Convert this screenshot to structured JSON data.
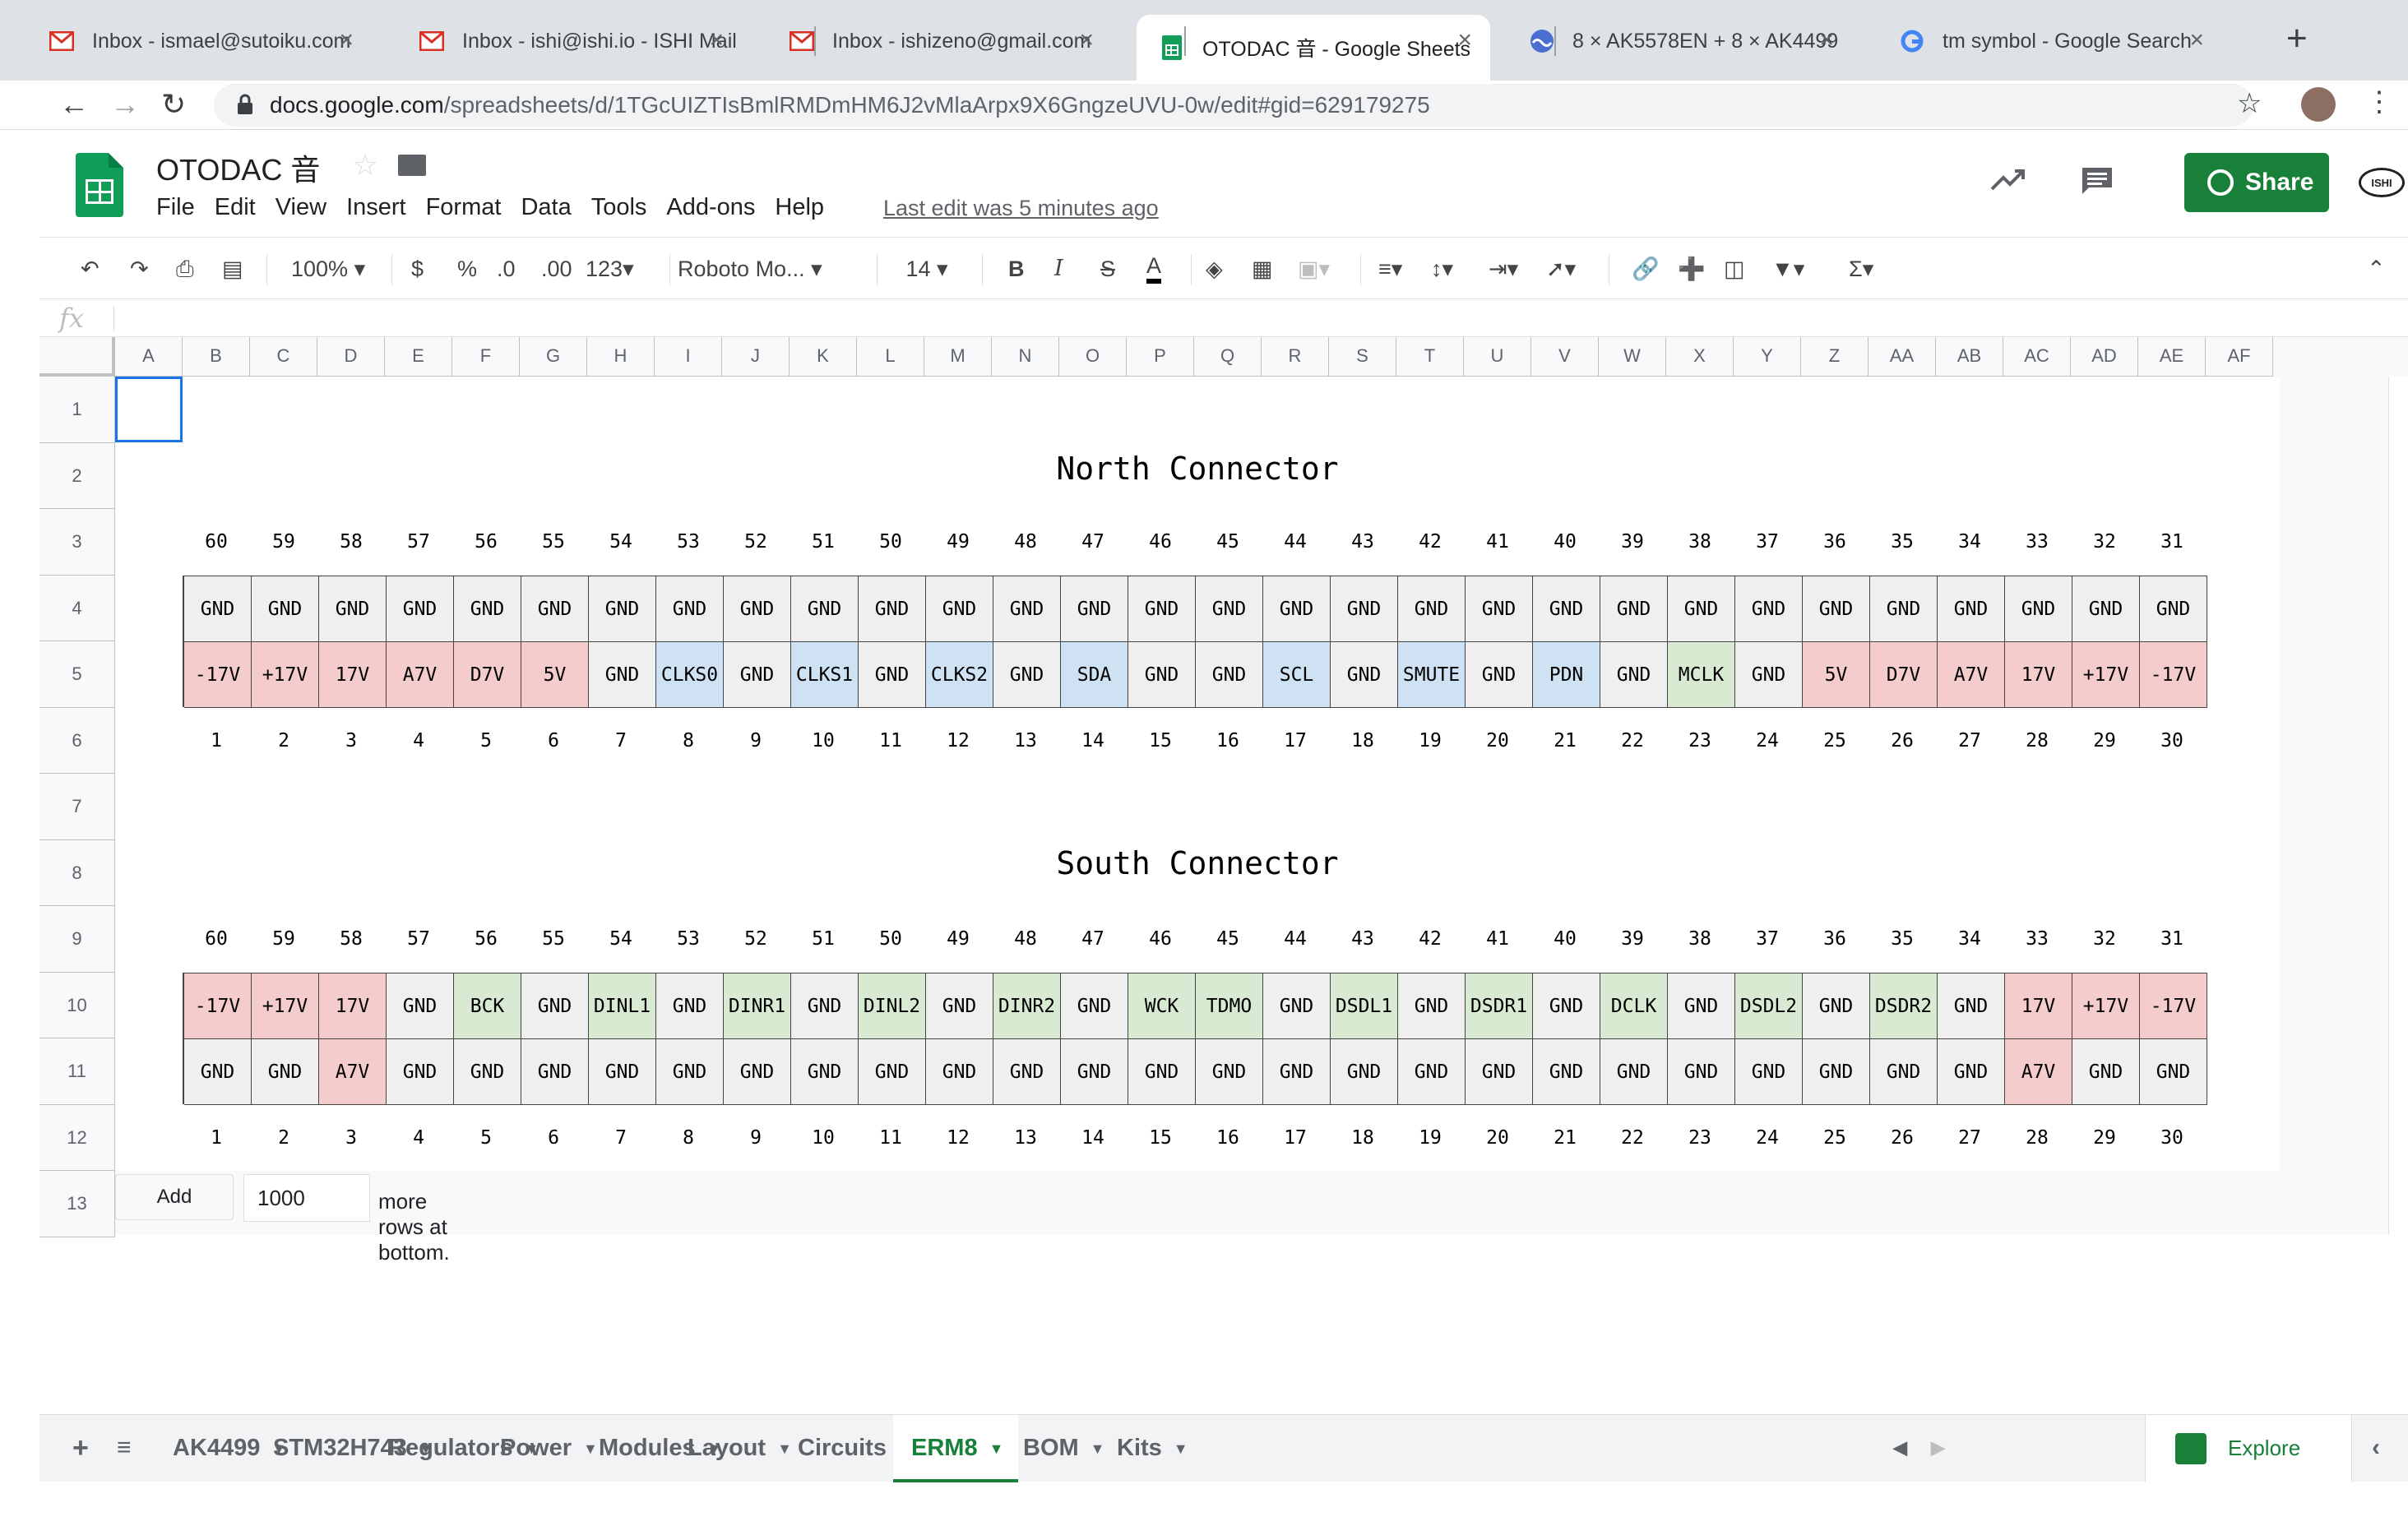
{
  "browser": {
    "tabs": [
      {
        "title": "Inbox - ismael@sutoiku.com",
        "favicon": "gmail-icon"
      },
      {
        "title": "Inbox - ishi@ishi.io - ISHI Mail",
        "favicon": "gmail-icon"
      },
      {
        "title": "Inbox - ishizeno@gmail.com",
        "favicon": "gmail-icon"
      },
      {
        "title": "OTODAC 音 - Google Sheets",
        "favicon": "sheets-icon",
        "active": true
      },
      {
        "title": "8 × AK5578EN + 8 × AK4499",
        "favicon": "wave-icon"
      },
      {
        "title": "tm symbol - Google Search",
        "favicon": "google-icon"
      }
    ],
    "url_host": "docs.google.com",
    "url_path": "/spreadsheets/d/1TGcUIZTIsBmlRMDmHM6J2vMlaArpx9X6GngzeUVU-0w/edit#gid=629179275"
  },
  "doc": {
    "title": "OTODAC 音",
    "menu": [
      "File",
      "Edit",
      "View",
      "Insert",
      "Format",
      "Data",
      "Tools",
      "Add-ons",
      "Help"
    ],
    "last_edit": "Last edit was 5 minutes ago",
    "share_label": "Share",
    "account_label": "ISHI"
  },
  "toolbar": {
    "zoom": "100%",
    "currency": "$",
    "percent": "%",
    "dec_minus": ".0",
    "dec_plus": ".00",
    "format": "123",
    "font": "Roboto Mo...",
    "font_size": "14",
    "bold": "B",
    "italic": "I",
    "strike": "S",
    "text_color": "A"
  },
  "formula_bar": {
    "label": "fx"
  },
  "grid": {
    "columns": [
      "A",
      "B",
      "C",
      "D",
      "E",
      "F",
      "G",
      "H",
      "I",
      "J",
      "K",
      "L",
      "M",
      "N",
      "O",
      "P",
      "Q",
      "R",
      "S",
      "T",
      "U",
      "V",
      "W",
      "X",
      "Y",
      "Z",
      "AA",
      "AB",
      "AC",
      "AD",
      "AE",
      "AF"
    ],
    "rows": [
      "1",
      "2",
      "3",
      "4",
      "5",
      "6",
      "7",
      "8",
      "9",
      "10",
      "11",
      "12",
      "13"
    ]
  },
  "colors": {
    "red": "#f4cccc",
    "blue": "#cfe2f3",
    "green": "#d9ead3",
    "grey": "#efefef"
  },
  "north": {
    "title": "North Connector",
    "top_numbers": [
      "60",
      "59",
      "58",
      "57",
      "56",
      "55",
      "54",
      "53",
      "52",
      "51",
      "50",
      "49",
      "48",
      "47",
      "46",
      "45",
      "44",
      "43",
      "42",
      "41",
      "40",
      "39",
      "38",
      "37",
      "36",
      "35",
      "34",
      "33",
      "32",
      "31"
    ],
    "row1": [
      [
        "GND",
        "grey"
      ],
      [
        "GND",
        "grey"
      ],
      [
        "GND",
        "grey"
      ],
      [
        "GND",
        "grey"
      ],
      [
        "GND",
        "grey"
      ],
      [
        "GND",
        "grey"
      ],
      [
        "GND",
        "grey"
      ],
      [
        "GND",
        "grey"
      ],
      [
        "GND",
        "grey"
      ],
      [
        "GND",
        "grey"
      ],
      [
        "GND",
        "grey"
      ],
      [
        "GND",
        "grey"
      ],
      [
        "GND",
        "grey"
      ],
      [
        "GND",
        "grey"
      ],
      [
        "GND",
        "grey"
      ],
      [
        "GND",
        "grey"
      ],
      [
        "GND",
        "grey"
      ],
      [
        "GND",
        "grey"
      ],
      [
        "GND",
        "grey"
      ],
      [
        "GND",
        "grey"
      ],
      [
        "GND",
        "grey"
      ],
      [
        "GND",
        "grey"
      ],
      [
        "GND",
        "grey"
      ],
      [
        "GND",
        "grey"
      ],
      [
        "GND",
        "grey"
      ],
      [
        "GND",
        "grey"
      ],
      [
        "GND",
        "grey"
      ],
      [
        "GND",
        "grey"
      ],
      [
        "GND",
        "grey"
      ],
      [
        "GND",
        "grey"
      ]
    ],
    "row2": [
      [
        "-17V",
        "red"
      ],
      [
        "+17V",
        "red"
      ],
      [
        "17V",
        "red"
      ],
      [
        "A7V",
        "red"
      ],
      [
        "D7V",
        "red"
      ],
      [
        "5V",
        "red"
      ],
      [
        "GND",
        "grey"
      ],
      [
        "CLKS0",
        "blue"
      ],
      [
        "GND",
        "grey"
      ],
      [
        "CLKS1",
        "blue"
      ],
      [
        "GND",
        "grey"
      ],
      [
        "CLKS2",
        "blue"
      ],
      [
        "GND",
        "grey"
      ],
      [
        "SDA",
        "blue"
      ],
      [
        "GND",
        "grey"
      ],
      [
        "GND",
        "grey"
      ],
      [
        "SCL",
        "blue"
      ],
      [
        "GND",
        "grey"
      ],
      [
        "SMUTE",
        "blue"
      ],
      [
        "GND",
        "grey"
      ],
      [
        "PDN",
        "blue"
      ],
      [
        "GND",
        "grey"
      ],
      [
        "MCLK",
        "green"
      ],
      [
        "GND",
        "grey"
      ],
      [
        "5V",
        "red"
      ],
      [
        "D7V",
        "red"
      ],
      [
        "A7V",
        "red"
      ],
      [
        "17V",
        "red"
      ],
      [
        "+17V",
        "red"
      ],
      [
        "-17V",
        "red"
      ]
    ],
    "bottom_numbers": [
      "1",
      "2",
      "3",
      "4",
      "5",
      "6",
      "7",
      "8",
      "9",
      "10",
      "11",
      "12",
      "13",
      "14",
      "15",
      "16",
      "17",
      "18",
      "19",
      "20",
      "21",
      "22",
      "23",
      "24",
      "25",
      "26",
      "27",
      "28",
      "29",
      "30"
    ]
  },
  "south": {
    "title": "South Connector",
    "top_numbers": [
      "60",
      "59",
      "58",
      "57",
      "56",
      "55",
      "54",
      "53",
      "52",
      "51",
      "50",
      "49",
      "48",
      "47",
      "46",
      "45",
      "44",
      "43",
      "42",
      "41",
      "40",
      "39",
      "38",
      "37",
      "36",
      "35",
      "34",
      "33",
      "32",
      "31"
    ],
    "row1": [
      [
        "-17V",
        "red"
      ],
      [
        "+17V",
        "red"
      ],
      [
        "17V",
        "red"
      ],
      [
        "GND",
        "grey"
      ],
      [
        "BCK",
        "green"
      ],
      [
        "GND",
        "grey"
      ],
      [
        "DINL1",
        "green"
      ],
      [
        "GND",
        "grey"
      ],
      [
        "DINR1",
        "green"
      ],
      [
        "GND",
        "grey"
      ],
      [
        "DINL2",
        "green"
      ],
      [
        "GND",
        "grey"
      ],
      [
        "DINR2",
        "green"
      ],
      [
        "GND",
        "grey"
      ],
      [
        "WCK",
        "green"
      ],
      [
        "TDMO",
        "green"
      ],
      [
        "GND",
        "grey"
      ],
      [
        "DSDL1",
        "green"
      ],
      [
        "GND",
        "grey"
      ],
      [
        "DSDR1",
        "green"
      ],
      [
        "GND",
        "grey"
      ],
      [
        "DCLK",
        "green"
      ],
      [
        "GND",
        "grey"
      ],
      [
        "DSDL2",
        "green"
      ],
      [
        "GND",
        "grey"
      ],
      [
        "DSDR2",
        "green"
      ],
      [
        "GND",
        "grey"
      ],
      [
        "17V",
        "red"
      ],
      [
        "+17V",
        "red"
      ],
      [
        "-17V",
        "red"
      ]
    ],
    "row2": [
      [
        "GND",
        "grey"
      ],
      [
        "GND",
        "grey"
      ],
      [
        "A7V",
        "red"
      ],
      [
        "GND",
        "grey"
      ],
      [
        "GND",
        "grey"
      ],
      [
        "GND",
        "grey"
      ],
      [
        "GND",
        "grey"
      ],
      [
        "GND",
        "grey"
      ],
      [
        "GND",
        "grey"
      ],
      [
        "GND",
        "grey"
      ],
      [
        "GND",
        "grey"
      ],
      [
        "GND",
        "grey"
      ],
      [
        "GND",
        "grey"
      ],
      [
        "GND",
        "grey"
      ],
      [
        "GND",
        "grey"
      ],
      [
        "GND",
        "grey"
      ],
      [
        "GND",
        "grey"
      ],
      [
        "GND",
        "grey"
      ],
      [
        "GND",
        "grey"
      ],
      [
        "GND",
        "grey"
      ],
      [
        "GND",
        "grey"
      ],
      [
        "GND",
        "grey"
      ],
      [
        "GND",
        "grey"
      ],
      [
        "GND",
        "grey"
      ],
      [
        "GND",
        "grey"
      ],
      [
        "GND",
        "grey"
      ],
      [
        "GND",
        "grey"
      ],
      [
        "A7V",
        "red"
      ],
      [
        "GND",
        "grey"
      ],
      [
        "GND",
        "grey"
      ]
    ],
    "bottom_numbers": [
      "1",
      "2",
      "3",
      "4",
      "5",
      "6",
      "7",
      "8",
      "9",
      "10",
      "11",
      "12",
      "13",
      "14",
      "15",
      "16",
      "17",
      "18",
      "19",
      "20",
      "21",
      "22",
      "23",
      "24",
      "25",
      "26",
      "27",
      "28",
      "29",
      "30"
    ]
  },
  "add_rows": {
    "button": "Add",
    "value": "1000",
    "suffix": "more rows at bottom."
  },
  "sheets": {
    "tabs": [
      "AK4499",
      "STM32H743",
      "Regulators",
      "Power",
      "Modules",
      "Layout",
      "Circuits",
      "ERM8",
      "BOM",
      "Kits"
    ],
    "active": "ERM8",
    "explore": "Explore"
  }
}
